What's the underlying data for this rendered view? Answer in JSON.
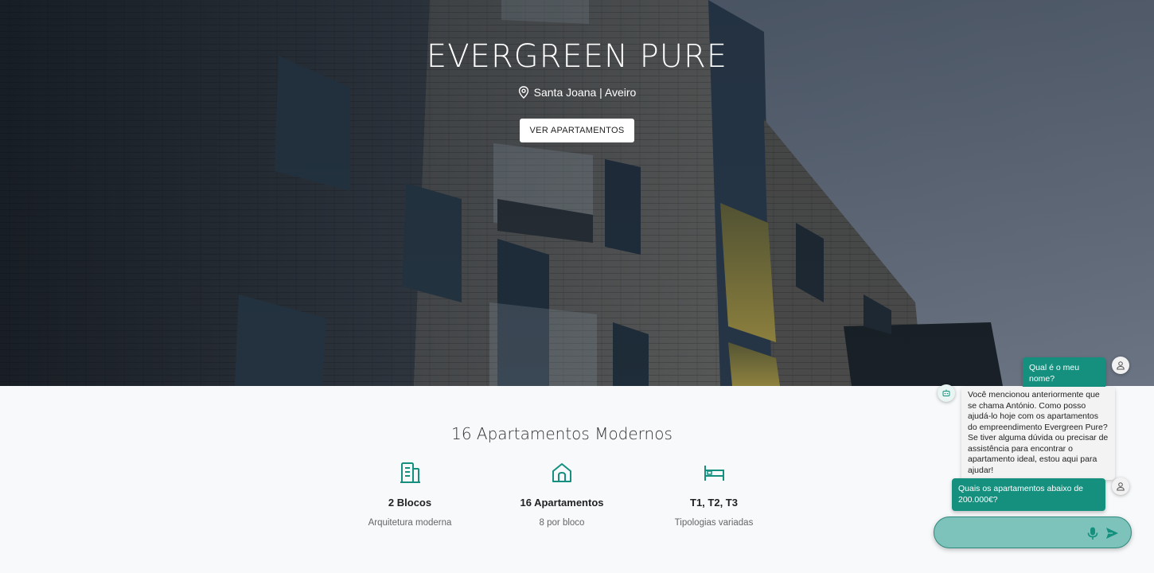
{
  "hero": {
    "title": "EVERGREEN PURE",
    "location": "Santa Joana | Aveiro",
    "cta_label": "VER APARTAMENTOS"
  },
  "features": {
    "heading": "16 Apartamentos Modernos",
    "items": [
      {
        "icon": "building-icon",
        "title": "2 Blocos",
        "subtitle": "Arquitetura moderna"
      },
      {
        "icon": "house-icon",
        "title": "16 Apartamentos",
        "subtitle": "8 por bloco"
      },
      {
        "icon": "bed-icon",
        "title": "T1, T2, T3",
        "subtitle": "Tipologias variadas"
      }
    ]
  },
  "chat": {
    "messages": [
      {
        "sender": "user",
        "text": "Qual é o meu nome?"
      },
      {
        "sender": "bot",
        "text": "Você mencionou anteriormente que se chama António. Como posso ajudá-lo hoje com os apartamentos do empreendimento Evergreen Pure? Se tiver alguma dúvida ou precisar de assistência para encontrar o apartamento ideal, estou aqui para ajudar!"
      },
      {
        "sender": "user",
        "text": "Quais os apartamentos abaixo de 200.000€?"
      }
    ],
    "input_value": "",
    "input_placeholder": ""
  },
  "colors": {
    "accent": "#15907f",
    "chat_input_bg": "#7dc3bb",
    "page_bg": "#f7f9fb"
  }
}
